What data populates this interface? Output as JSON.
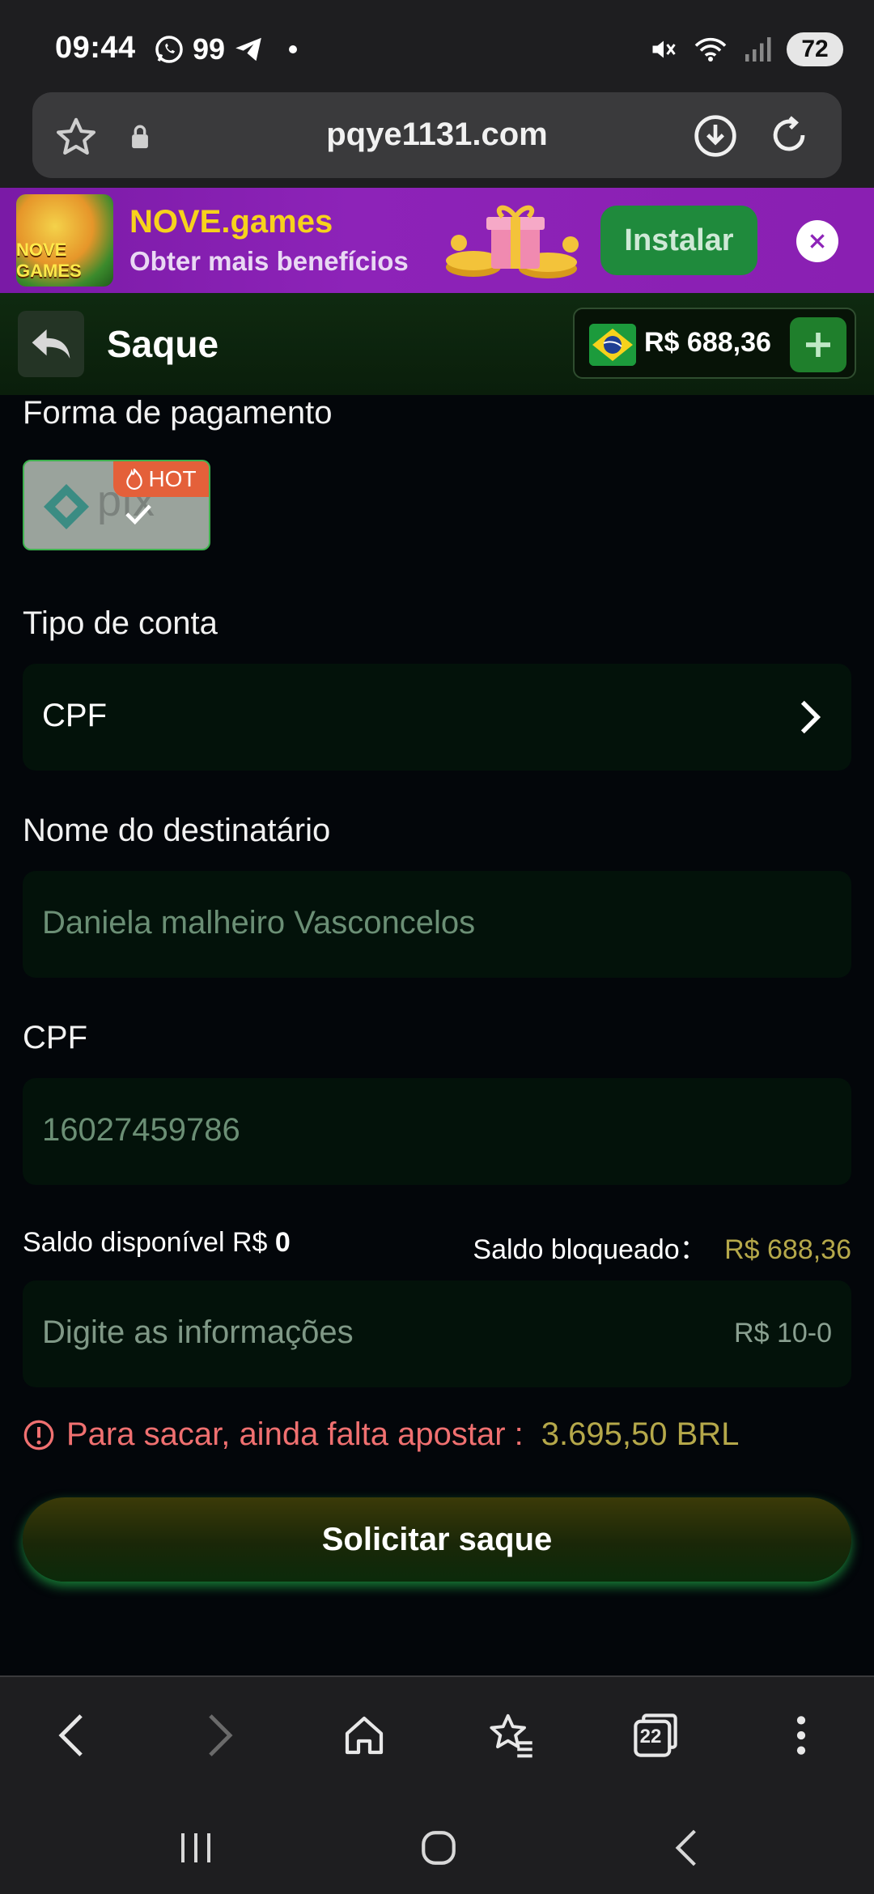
{
  "status_bar": {
    "time": "09:44",
    "notification_count": "99",
    "battery": "72"
  },
  "browser": {
    "url": "pqye1131.com"
  },
  "install_banner": {
    "logo_text": "NOVE GAMES",
    "title": "NOVE.games",
    "subtitle": "Obter mais benefícios",
    "install_label": "Instalar"
  },
  "header": {
    "title": "Saque",
    "balance": "R$ 688,36"
  },
  "form": {
    "payment_label": "Forma de pagamento",
    "payment_method": "pix",
    "hot_badge": "HOT",
    "account_type_label": "Tipo de conta",
    "account_type_value": "CPF",
    "recipient_label": "Nome do destinatário",
    "recipient_value": "Daniela malheiro Vasconcelos",
    "cpf_label": "CPF",
    "cpf_value": "16027459786",
    "saldo_disponivel_label": "Saldo disponível R$",
    "saldo_disponivel_value": "0",
    "saldo_bloqueado_label": "Saldo bloqueado：",
    "saldo_bloqueado_value": "R$ 688,36",
    "amount_placeholder": "Digite as informações",
    "amount_range": "R$ 10-0",
    "warning_text": "Para sacar, ainda falta apostar :",
    "warning_amount": "3.695,50 BRL",
    "submit_label": "Solicitar saque"
  },
  "browser_nav": {
    "tabs_count": "22"
  },
  "colors": {
    "accent_green": "#1f8a3c",
    "warning_red": "#f07070",
    "gold": "#b5a84a",
    "banner_purple": "#8d23b8"
  }
}
